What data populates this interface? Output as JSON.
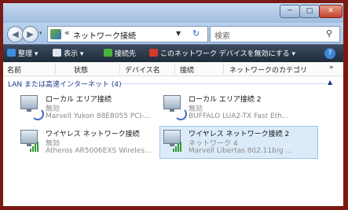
{
  "window": {
    "controls": {
      "minimize": "─",
      "maximize": "□",
      "close": "✕"
    }
  },
  "address": {
    "back": "◀",
    "forward": "▶",
    "history": "▾",
    "separator": "«",
    "path": "ネットワーク接続",
    "dropdown": "▼",
    "refresh": "↻",
    "search_placeholder": "検索",
    "search_icon": "search-icon"
  },
  "commandbar": {
    "organize": "整理 ▾",
    "views": "表示 ▾",
    "connect": "接続先",
    "disable": "このネットワーク デバイスを無効にする ▾",
    "help": "?"
  },
  "columns": [
    "名前",
    "状態",
    "デバイス名",
    "接続",
    "ネットワークのカテゴリ"
  ],
  "columns_more": "»",
  "group": {
    "title": "LAN または高速インターネット (4)",
    "collapse": "▲"
  },
  "connections": [
    {
      "name": "ローカル エリア接続",
      "status": "無効",
      "device": "Marvell Yukon 88E8055 PCI-...",
      "type": "wired",
      "selected": false
    },
    {
      "name": "ローカル エリア接続 2",
      "status": "無効",
      "device": "BUFFALO LUA2-TX Fast Eth...",
      "type": "wired",
      "selected": false
    },
    {
      "name": "ワイヤレス ネットワーク接続",
      "status": "無効",
      "device": "Atheros AR5006EXS Wireles...",
      "type": "wireless",
      "selected": false
    },
    {
      "name": "ワイヤレス ネットワーク接続 2",
      "status": "ネットワーク 4",
      "device": "Marvell Libertas 802.11b/g ...",
      "type": "wireless",
      "selected": true
    }
  ],
  "colors": {
    "frame": "#7a1a12",
    "titlebar": "#b3cce8",
    "commandbar": "#2a3849",
    "selection": "#dcebf9",
    "group_text": "#1e3a8c"
  }
}
